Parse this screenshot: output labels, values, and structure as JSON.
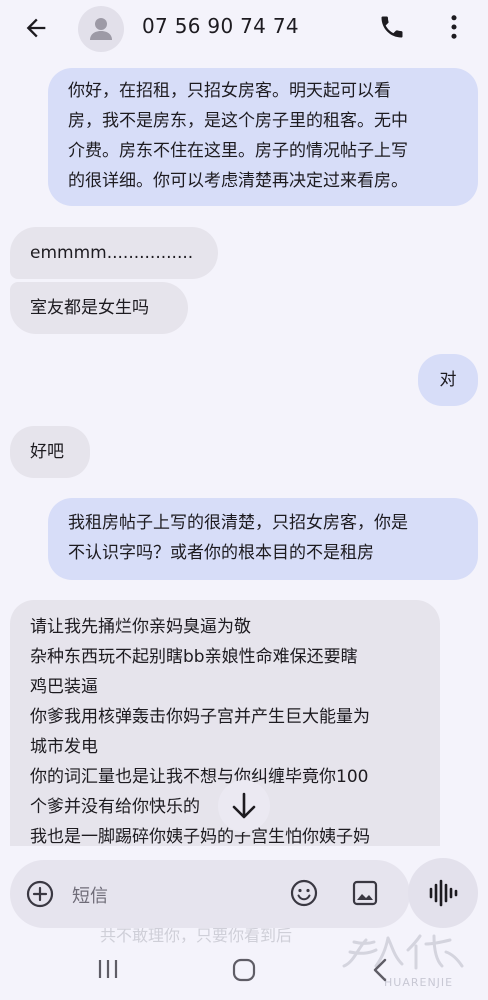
{
  "header": {
    "title": "07 56 90 74 74"
  },
  "messages": [
    {
      "dir": "out",
      "lines": [
        "你好，在招租，只招女房客。明天起可以看",
        "房，我不是房东，是这个房子里的租客。无中",
        "介费。房东不住在这里。房子的情况帖子上写",
        "的很详细。你可以考虑清楚再决定过来看房。"
      ]
    },
    {
      "dir": "in",
      "lines": [
        "emmmm................"
      ]
    },
    {
      "dir": "in",
      "lines": [
        "室友都是女生吗"
      ]
    },
    {
      "dir": "out",
      "lines": [
        "对"
      ]
    },
    {
      "dir": "in",
      "lines": [
        "好吧"
      ]
    },
    {
      "dir": "out",
      "lines": [
        "我租房帖子上写的很清楚，只招女房客，你是",
        "不认识字吗？或者你的根本目的不是租房"
      ]
    },
    {
      "dir": "in",
      "lines": [
        "请让我先捅烂你亲妈臭逼为敬",
        "杂种东西玩不起别瞎bb亲娘性命难保还要瞎",
        "鸡巴装逼",
        "你爹我用核弹轰击你妈子宫并产生巨大能量为",
        "城市发电",
        "你的词汇量也是让我不想与你纠缠毕竟你100",
        "个爹并没有给你快乐的",
        "我也是一脚踢碎你姨子妈的子宫生怕你姨子妈"
      ]
    }
  ],
  "composer": {
    "placeholder": "短信"
  },
  "background_text": "共不敢理你，只要你看到后",
  "watermark": {
    "text": "HUARENJIE",
    "glyphs": "華人街"
  },
  "colors": {
    "background": "#f4f3fb",
    "outgoing_bubble": "#d7ddf8",
    "incoming_bubble": "#e6e4ec"
  }
}
